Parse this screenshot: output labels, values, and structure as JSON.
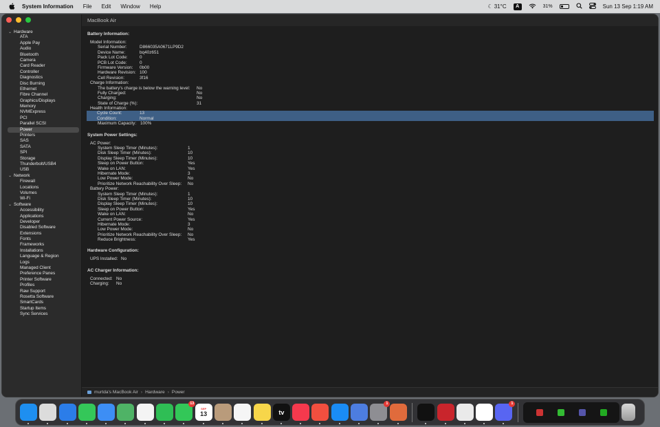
{
  "menubar": {
    "app_name": "System Information",
    "menus": [
      "File",
      "Edit",
      "Window",
      "Help"
    ],
    "weather": "31°C",
    "keyboard": "A",
    "battery": "31%",
    "battery_level": 0.31,
    "datetime": "Sun 13 Sep  1:19 AM"
  },
  "window": {
    "title": "MacBook Air"
  },
  "sidebar": {
    "groups": [
      {
        "label": "Hardware",
        "items": [
          "ATA",
          "Apple Pay",
          "Audio",
          "Bluetooth",
          "Camera",
          "Card Reader",
          "Controller",
          "Diagnostics",
          "Disc Burning",
          "Ethernet",
          "Fibre Channel",
          "Graphics/Displays",
          "Memory",
          "NVMExpress",
          "PCI",
          "Parallel SCSI",
          "Power",
          "Printers",
          "SAS",
          "SATA",
          "SPI",
          "Storage",
          "Thunderbolt/USB4",
          "USB"
        ]
      },
      {
        "label": "Network",
        "items": [
          "Firewall",
          "Locations",
          "Volumes",
          "Wi-Fi"
        ]
      },
      {
        "label": "Software",
        "items": [
          "Accessibility",
          "Applications",
          "Developer",
          "Disabled Software",
          "Extensions",
          "Fonts",
          "Frameworks",
          "Installations",
          "Language & Region",
          "Logs",
          "Managed Client",
          "Preference Panes",
          "Printer Software",
          "Profiles",
          "Raw Support",
          "Rosetta Software",
          "SmartCards",
          "Startup Items",
          "Sync Services"
        ]
      }
    ],
    "selected": "Power"
  },
  "content": {
    "battery_info_title": "Battery Information:",
    "model_info_label": "Model Information:",
    "model_info": [
      [
        "Serial Number:",
        "D866035A0671LP9D2"
      ],
      [
        "Device Name:",
        "bq40z651"
      ],
      [
        "Pack Lot Code:",
        "0"
      ],
      [
        "PCB Lot Code:",
        "0"
      ],
      [
        "Firmware Version:",
        "0b00"
      ],
      [
        "Hardware Revision:",
        "100"
      ],
      [
        "Cell Revision:",
        "3f16"
      ]
    ],
    "charge_info_label": "Charge Information:",
    "charge_info": [
      [
        "The battery's charge is below the warning level:",
        "No"
      ],
      [
        "Fully Charged:",
        "No"
      ],
      [
        "Charging:",
        "No"
      ],
      [
        "State of Charge (%):",
        "31"
      ]
    ],
    "health_info_label": "Health Information:",
    "health_info": [
      [
        "Cycle Count:",
        "13"
      ],
      [
        "Condition:",
        "Normal"
      ],
      [
        "Maximum Capacity:",
        "100%"
      ]
    ],
    "power_settings_title": "System Power Settings:",
    "ac_power_label": "AC Power:",
    "ac_power": [
      [
        "System Sleep Timer (Minutes):",
        "1"
      ],
      [
        "Disk Sleep Timer (Minutes):",
        "10"
      ],
      [
        "Display Sleep Timer (Minutes):",
        "10"
      ],
      [
        "Sleep on Power Button:",
        "Yes"
      ],
      [
        "Wake on LAN:",
        "Yes"
      ],
      [
        "Hibernate Mode:",
        "3"
      ],
      [
        "Low Power Mode:",
        "No"
      ],
      [
        "Prioritize Network Reachability Over Sleep:",
        "No"
      ]
    ],
    "battery_power_label": "Battery Power:",
    "battery_power": [
      [
        "System Sleep Timer (Minutes):",
        "1"
      ],
      [
        "Disk Sleep Timer (Minutes):",
        "10"
      ],
      [
        "Display Sleep Timer (Minutes):",
        "10"
      ],
      [
        "Sleep on Power Button:",
        "Yes"
      ],
      [
        "Wake on LAN:",
        "No"
      ],
      [
        "Current Power Source:",
        "Yes"
      ],
      [
        "Hibernate Mode:",
        "3"
      ],
      [
        "Low Power Mode:",
        "No"
      ],
      [
        "Prioritize Network Reachability Over Sleep:",
        "No"
      ],
      [
        "Reduce Brightness:",
        "Yes"
      ]
    ],
    "hw_config_title": "Hardware Configuration:",
    "hw_config": [
      [
        "UPS Installed:",
        "No"
      ]
    ],
    "ac_charger_title": "AC Charger Information:",
    "ac_charger": [
      [
        "Connected:",
        "No"
      ],
      [
        "Charging:",
        "No"
      ]
    ]
  },
  "pathbar": {
    "items": [
      "murtda's MacBook Air",
      "Hardware",
      "Power"
    ]
  },
  "dock": {
    "apps": [
      {
        "name": "finder",
        "color": "#1e8ff0",
        "badge": ""
      },
      {
        "name": "launchpad",
        "color": "#dcdcdc",
        "badge": ""
      },
      {
        "name": "safari",
        "color": "#2b7de9",
        "badge": ""
      },
      {
        "name": "messages",
        "color": "#34c759",
        "badge": ""
      },
      {
        "name": "mail",
        "color": "#3d8ef5",
        "badge": ""
      },
      {
        "name": "maps",
        "color": "#4fb366",
        "badge": ""
      },
      {
        "name": "photos",
        "color": "#f4f4f4",
        "badge": ""
      },
      {
        "name": "facetime",
        "color": "#2fbe55",
        "badge": ""
      },
      {
        "name": "phone",
        "color": "#33c758",
        "badge": "13"
      },
      {
        "name": "calendar",
        "color": "#ffffff",
        "badge": ""
      },
      {
        "name": "contacts",
        "color": "#b99b7b",
        "badge": ""
      },
      {
        "name": "reminders",
        "color": "#f5f5f5",
        "badge": ""
      },
      {
        "name": "notes",
        "color": "#f7d64a",
        "badge": ""
      },
      {
        "name": "apple-tv",
        "color": "#111111",
        "badge": ""
      },
      {
        "name": "music",
        "color": "#f5394d",
        "badge": ""
      },
      {
        "name": "rocket-typist",
        "color": "#f24f3f",
        "badge": ""
      },
      {
        "name": "app-store",
        "color": "#1a8cf5",
        "badge": ""
      },
      {
        "name": "simulator",
        "color": "#4d7de0",
        "badge": ""
      },
      {
        "name": "system-preferences",
        "color": "#8e8e93",
        "badge": "1"
      },
      {
        "name": "claude",
        "color": "#e06b3c",
        "badge": ""
      },
      {
        "name": "spotify",
        "color": "#111111",
        "badge": ""
      },
      {
        "name": "parallels",
        "color": "#c9252c",
        "badge": ""
      },
      {
        "name": "preview-app",
        "color": "#eaeaea",
        "badge": ""
      },
      {
        "name": "chrome",
        "color": "#ffffff",
        "badge": ""
      },
      {
        "name": "discord",
        "color": "#5865f2",
        "badge": "1"
      }
    ],
    "calendar_day": "13",
    "calendar_month": "SEP",
    "tv_label": "tv"
  }
}
